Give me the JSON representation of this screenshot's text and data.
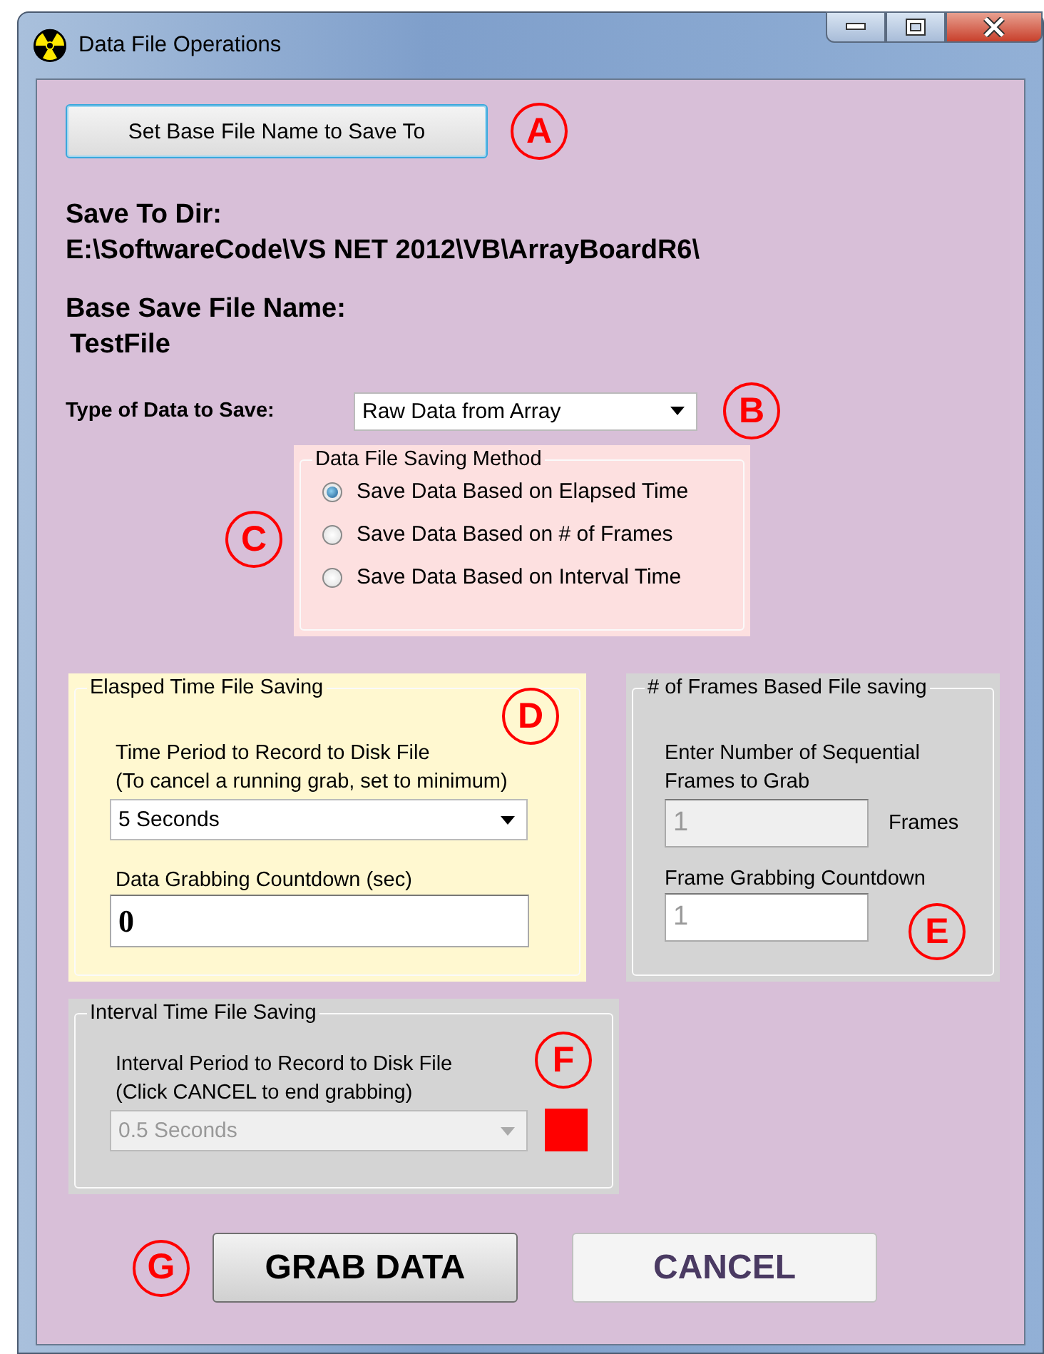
{
  "window": {
    "title": "Data File Operations"
  },
  "base_name_button": {
    "label": "Set Base File Name to Save To",
    "callout": "A"
  },
  "save_dir": {
    "label": "Save To Dir:",
    "value": "E:\\SoftwareCode\\VS NET 2012\\VB\\ArrayBoardR6\\"
  },
  "base_file": {
    "label": "Base Save File Name:",
    "value": "TestFile"
  },
  "data_type": {
    "label": "Type of Data to Save:",
    "value": "Raw Data from Array",
    "callout": "B"
  },
  "saving_method": {
    "title": "Data File Saving Method",
    "callout": "C",
    "options": [
      {
        "label": "Save Data Based on Elapsed Time",
        "selected": true
      },
      {
        "label": "Save Data Based on # of Frames",
        "selected": false
      },
      {
        "label": "Save Data Based on Interval Time",
        "selected": false
      }
    ]
  },
  "elapsed_group": {
    "title": "Elasped Time File Saving",
    "callout": "D",
    "disabled": false,
    "period_label": [
      "Time Period to Record to Disk File",
      "(To cancel a running grab, set to minimum)"
    ],
    "period_value": "5 Seconds",
    "countdown_label": "Data Grabbing Countdown (sec)",
    "countdown_value": "0"
  },
  "frames_group": {
    "title": "# of Frames Based File saving",
    "callout": "E",
    "disabled": true,
    "count_label": [
      "Enter Number of Sequential",
      "Frames to Grab"
    ],
    "count_value": "1",
    "unit": "Frames",
    "countdown_label": "Frame Grabbing Countdown",
    "countdown_value": "1"
  },
  "interval_group": {
    "title": "Interval Time File Saving",
    "callout": "F",
    "disabled": true,
    "period_label": [
      "Interval Period to Record to Disk File",
      "(Click CANCEL to end grabbing)"
    ],
    "period_value": "0.5 Seconds",
    "indicator": {
      "color": "#ff0000"
    }
  },
  "actions": [
    {
      "label": "GRAB DATA",
      "kind": "primary",
      "callout": "G"
    },
    {
      "label": "CANCEL",
      "kind": "plain"
    }
  ]
}
